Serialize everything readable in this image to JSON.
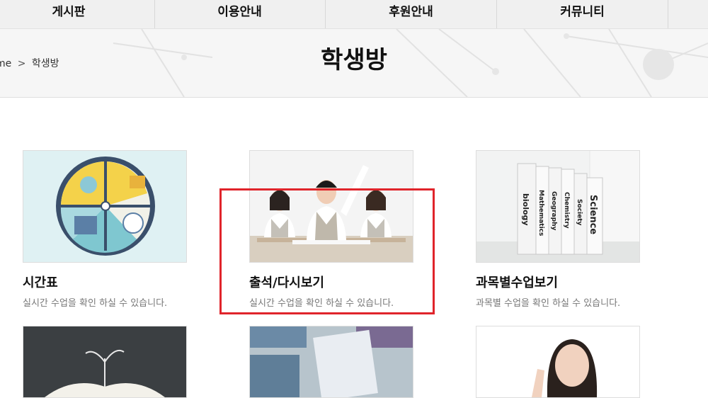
{
  "nav": {
    "items": [
      "게시판",
      "이용안내",
      "후원안내",
      "커뮤니티"
    ]
  },
  "breadcrumb": {
    "home": "me",
    "separator": ">",
    "current": "학생방"
  },
  "page_title": "학생방",
  "cards": [
    {
      "title": "시간표",
      "desc": "실시간 수업을 확인 하실 수 있습니다."
    },
    {
      "title": "출석/다시보기",
      "desc": "실시간 수업을 확인 하실 수 있습니다."
    },
    {
      "title": "과목별수업보기",
      "desc": "과목별 수업을 확인 하실 수 있습니다."
    }
  ],
  "books": [
    "biology",
    "Mathematics",
    "Geography",
    "Chemistry",
    "Society",
    "Science"
  ],
  "colors": {
    "highlight": "#e0242b",
    "nav_bg": "#f0f0f0"
  }
}
